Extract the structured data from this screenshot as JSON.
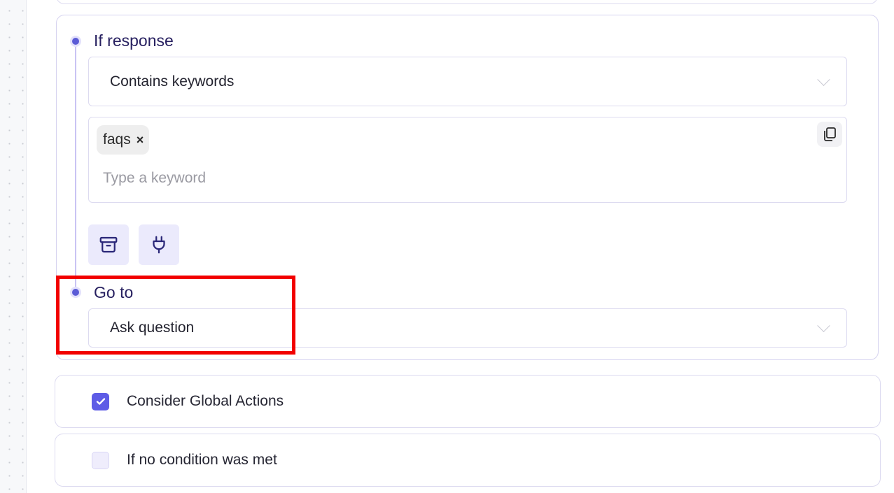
{
  "condition": {
    "if_label": "If response",
    "match_type": "Contains keywords",
    "keywords": [
      "faqs"
    ],
    "tag_remove_glyph": "×",
    "keyword_placeholder": "Type a keyword",
    "copy_icon": "copy-icon",
    "action_icons": [
      "archive-icon",
      "plug-icon"
    ],
    "goto_label": "Go to",
    "goto_target": "Ask question"
  },
  "options": [
    {
      "label": "Consider Global Actions",
      "checked": true
    },
    {
      "label": "If no condition was met",
      "checked": false
    }
  ],
  "colors": {
    "accent": "#5e5ce6",
    "heading": "#272060",
    "highlight": "#f20000",
    "border": "#dcdaf0"
  }
}
